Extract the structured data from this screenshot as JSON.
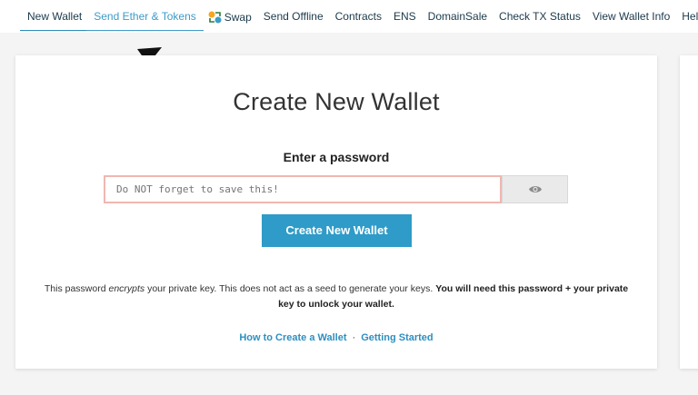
{
  "nav": {
    "items": [
      {
        "label": "New Wallet"
      },
      {
        "label": "Send Ether & Tokens"
      },
      {
        "label": "Swap"
      },
      {
        "label": "Send Offline"
      },
      {
        "label": "Contracts"
      },
      {
        "label": "ENS"
      },
      {
        "label": "DomainSale"
      },
      {
        "label": "Check TX Status"
      },
      {
        "label": "View Wallet Info"
      },
      {
        "label": "Help"
      }
    ]
  },
  "card": {
    "title": "Create New Wallet",
    "password_label": "Enter a password",
    "password_placeholder": "Do NOT forget to save this!",
    "create_button": "Create New Wallet",
    "note_part1": "This password ",
    "note_em": "encrypts",
    "note_part2": " your private key. This does not act as a seed to generate your keys. ",
    "note_bold1": "You will need this password + your private",
    "note_bold2": "key to unlock your wallet.",
    "link_how": "How to Create a Wallet",
    "link_sep": "·",
    "link_started": "Getting Started"
  },
  "colors": {
    "accent": "#2e9bc8",
    "input_border_error": "#f0b7b0"
  },
  "icons": {
    "swap": "swap-icon",
    "eye": "eye-icon"
  }
}
